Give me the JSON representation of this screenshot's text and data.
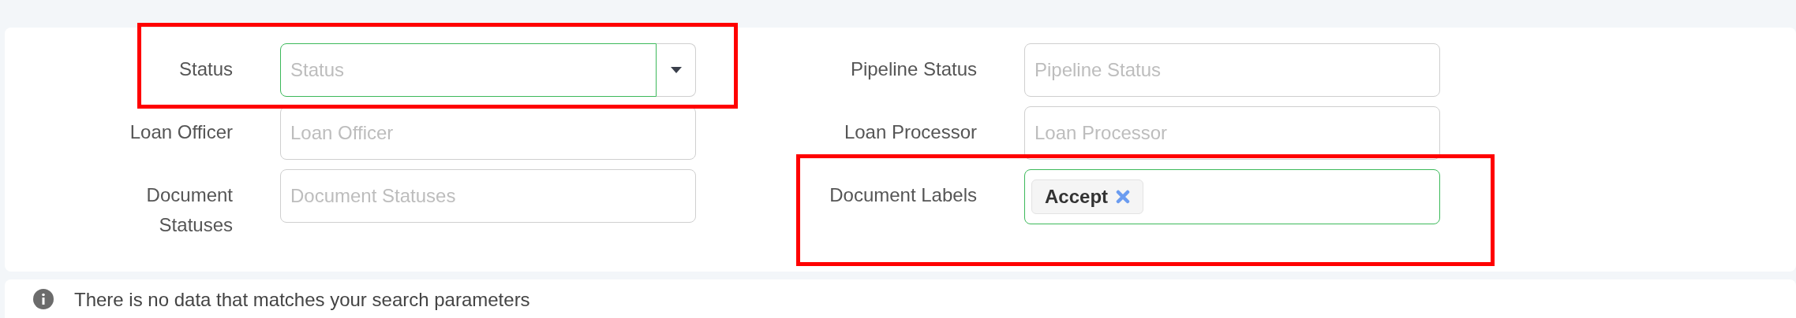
{
  "left_fields": [
    {
      "label": "Status",
      "placeholder": "Status",
      "kind": "dropdown",
      "focused": true,
      "highlighted": true
    },
    {
      "label": "Loan Officer",
      "placeholder": "Loan Officer",
      "kind": "text",
      "focused": false,
      "highlighted": false
    },
    {
      "label": "Document Statuses",
      "placeholder": "Document Statuses",
      "kind": "text",
      "focused": false,
      "highlighted": false
    }
  ],
  "right_fields": [
    {
      "label": "Pipeline Status",
      "placeholder": "Pipeline Status",
      "kind": "text",
      "focused": false,
      "highlighted": false
    },
    {
      "label": "Loan Processor",
      "placeholder": "Loan Processor",
      "kind": "text",
      "focused": false,
      "highlighted": false
    },
    {
      "label": "Document Labels",
      "kind": "tags",
      "tags": [
        {
          "label": "Accept"
        }
      ],
      "focused": true,
      "highlighted": true
    }
  ],
  "message": "There is no data that matches your search parameters"
}
